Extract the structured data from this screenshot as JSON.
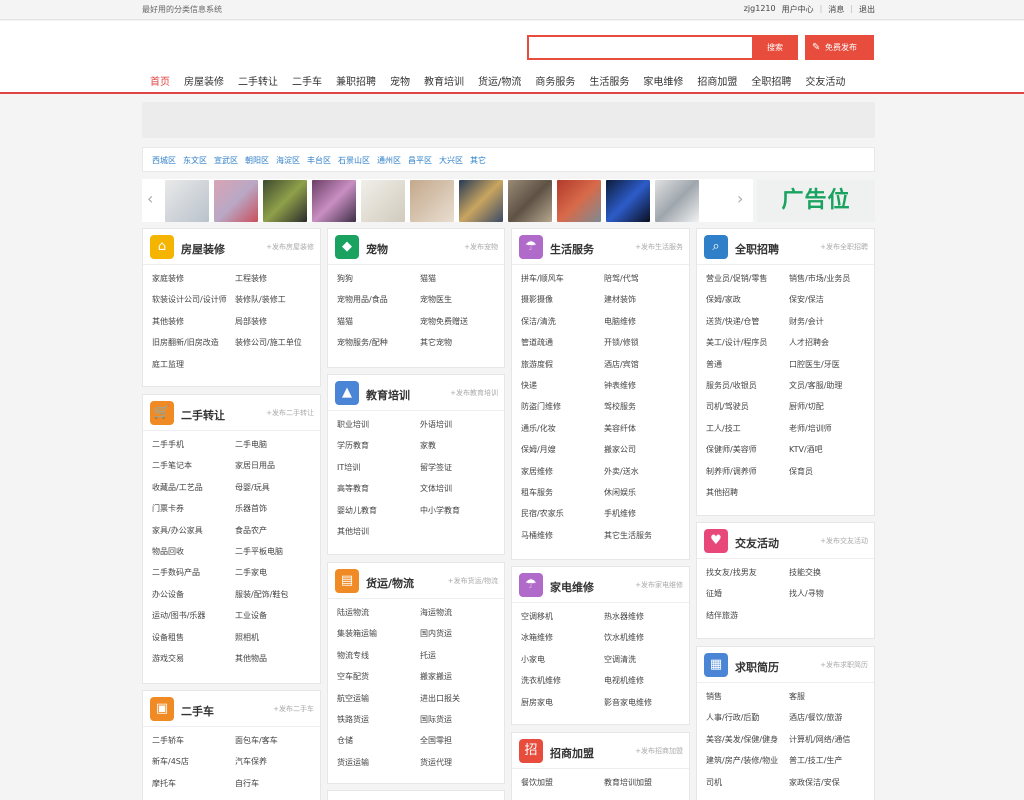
{
  "topbar": {
    "slogan": "最好用的分类信息系统",
    "user": "zjg1210",
    "user_center": "用户中心",
    "messages": "消息",
    "logout": "退出"
  },
  "header": {
    "search_button": "搜索",
    "publish_button": "免费发布",
    "nav": [
      "首页",
      "房屋装修",
      "二手转让",
      "二手车",
      "兼职招聘",
      "宠物",
      "教育培训",
      "货运/物流",
      "商务服务",
      "生活服务",
      "家电维修",
      "招商加盟",
      "全职招聘",
      "交友活动"
    ]
  },
  "districts": [
    "西城区",
    "东文区",
    "宣武区",
    "朝阳区",
    "海淀区",
    "丰台区",
    "石景山区",
    "通州区",
    "昌平区",
    "大兴区",
    "其它"
  ],
  "ad_text": "广告位",
  "colors": {
    "accent": "#e74c3c",
    "link": "#2f80c8"
  },
  "cards": {
    "fangwu": {
      "title": "房屋装修",
      "pub": "+发布房屋装修",
      "icon": "house-icon",
      "color": "#f5b400",
      "items": [
        "家庭装修",
        "工程装修",
        "软装设计公司/设计师",
        "装修队/装修工",
        "其他装修",
        "局部装修",
        "旧房翻新/旧房改造",
        "装修公司/施工单位",
        "庭工监理"
      ]
    },
    "ershou": {
      "title": "二手转让",
      "pub": "+发布二手转让",
      "icon": "cart-icon",
      "color": "#f08a24",
      "items": [
        "二手手机",
        "二手电脑",
        "二手笔记本",
        "家居日用品",
        "收藏品/工艺品",
        "母婴/玩具",
        "门票卡券",
        "乐器首饰",
        "家具/办公家具",
        "食品农产",
        "物品回收",
        "二手平板电脑",
        "二手数码产品",
        "二手家电",
        "办公设备",
        "服装/配饰/鞋包",
        "运动/图书/乐器",
        "工业设备",
        "设备租售",
        "照相机",
        "游戏交易",
        "其他物品"
      ]
    },
    "ershouche": {
      "title": "二手车",
      "pub": "+发布二手车",
      "icon": "car-icon",
      "color": "#f08a24",
      "items": [
        "二手轿车",
        "面包车/客车",
        "新车/4S店",
        "汽车保养",
        "摩托车",
        "自行车"
      ]
    },
    "chongwu": {
      "title": "宠物",
      "pub": "+发布宠物",
      "icon": "paw-icon",
      "color": "#1aa260",
      "items": [
        "狗狗",
        "猫猫",
        "宠物用品/食品",
        "宠物医生",
        "猫猫",
        "宠物免费赠送",
        "宠物服务/配种",
        "其它宠物"
      ]
    },
    "jiaoyu": {
      "title": "教育培训",
      "pub": "+发布教育培训",
      "icon": "graduation-cap-icon",
      "color": "#4b86d6",
      "items": [
        "职业培训",
        "外语培训",
        "学历教育",
        "家教",
        "IT培训",
        "留学签证",
        "高等教育",
        "文体培训",
        "婴幼儿教育",
        "中小学教育",
        "其他培训"
      ]
    },
    "huoyun": {
      "title": "货运/物流",
      "pub": "+发布货运/物流",
      "icon": "truck-icon",
      "color": "#f08a24",
      "items": [
        "陆运物流",
        "海运物流",
        "集装箱运输",
        "国内货运",
        "物流专线",
        "托运",
        "空车配货",
        "搬家搬运",
        "航空运输",
        "进出口报关",
        "铁路货运",
        "国际货运",
        "仓储",
        "全国零担",
        "货运运输",
        "货运代理"
      ]
    },
    "shenghuo": {
      "title": "生活服务",
      "pub": "+发布生活服务",
      "icon": "umbrella-icon",
      "color": "#b06ac9",
      "items": [
        "拼车/顺风车",
        "陪驾/代驾",
        "摄影摄像",
        "建材装饰",
        "保洁/清洗",
        "电脑维修",
        "管道疏通",
        "开锁/修锁",
        "旅游度假",
        "酒店/宾馆",
        "快递",
        "钟表维修",
        "防盗门维修",
        "驾校服务",
        "通乐/化妆",
        "美容纤体",
        "保姆/月嫂",
        "搬家公司",
        "家居维修",
        "外卖/送水",
        "租车服务",
        "休闲娱乐",
        "民宿/农家乐",
        "手机维修",
        "马桶维修",
        "其它生活服务"
      ]
    },
    "jiadian": {
      "title": "家电维修",
      "pub": "+发布家电维修",
      "icon": "umbrella-icon",
      "color": "#b06ac9",
      "items": [
        "空调移机",
        "热水器维修",
        "冰箱维修",
        "饮水机维修",
        "小家电",
        "空调清洗",
        "洗衣机维修",
        "电视机维修",
        "厨房家电",
        "影音家电维修"
      ]
    },
    "zhaoshang": {
      "title": "招商加盟",
      "pub": "+发布招商加盟",
      "icon": "zhao-icon",
      "color": "#e74c3c",
      "items": [
        "餐饮加盟",
        "教育培训加盟"
      ]
    },
    "quanzhi": {
      "title": "全职招聘",
      "pub": "+发布全职招聘",
      "icon": "search-person-icon",
      "color": "#2f80c8",
      "items": [
        "营业员/促销/零售",
        "销售/市场/业务员",
        "保姆/家政",
        "保安/保洁",
        "送货/快递/仓管",
        "财务/会计",
        "美工/设计/程序员",
        "人才招聘会",
        "普通",
        "口腔医生/牙医",
        "服务员/收银员",
        "文员/客服/助理",
        "司机/驾驶员",
        "厨师/切配",
        "工人/技工",
        "老师/培训师",
        "保健师/美容师",
        "KTV/酒吧",
        "制养师/调养师",
        "保育员",
        "其他招聘"
      ]
    },
    "jiaoyou": {
      "title": "交友活动",
      "pub": "+发布交友活动",
      "icon": "heart-icon",
      "color": "#e8477a",
      "items": [
        "找女友/找男友",
        "技能交换",
        "征婚",
        "找人/寻物",
        "结伴旅游"
      ]
    },
    "qiuzhi": {
      "title": "求职简历",
      "pub": "+发布求职简历",
      "icon": "calendar-icon",
      "color": "#4b86d6",
      "items": [
        "销售",
        "客服",
        "人事/行政/后勤",
        "酒店/餐饮/旅游",
        "美容/美发/保健/健身",
        "计算机/网络/通信",
        "建筑/房产/装修/物业",
        "普工/技工/生产",
        "司机",
        "家政保洁/安保"
      ]
    }
  }
}
